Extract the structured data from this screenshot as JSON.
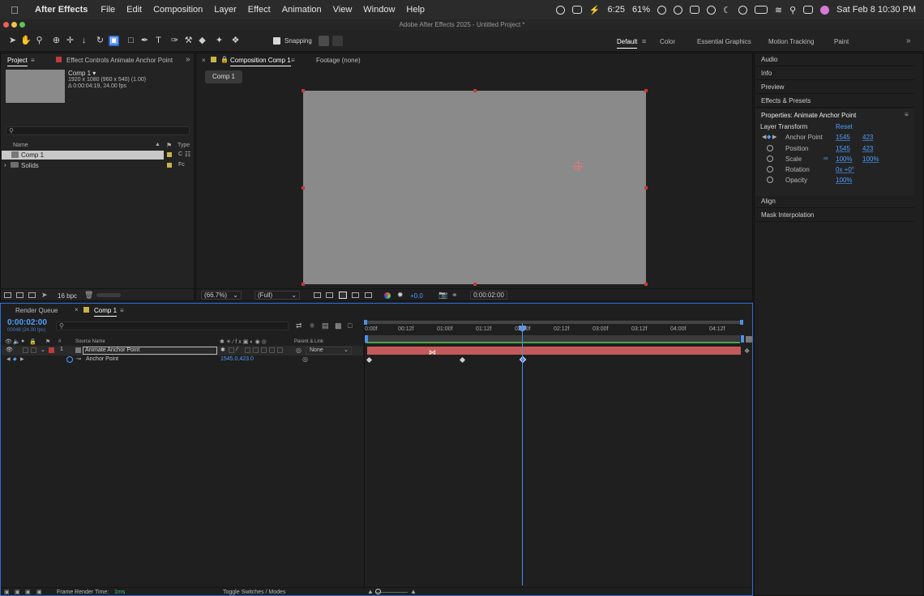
{
  "menubar": {
    "app_name": "After Effects",
    "items": [
      "File",
      "Edit",
      "Composition",
      "Layer",
      "Effect",
      "Animation",
      "View",
      "Window",
      "Help"
    ],
    "battery_time": "6:25",
    "battery_pct": "61%",
    "datetime": "Sat Feb 8  10:30 PM"
  },
  "window": {
    "title": "Adobe After Effects 2025 - Untitled Project *"
  },
  "toolbar": {
    "snapping_label": "Snapping",
    "workspaces": [
      "Default",
      "Color",
      "Essential Graphics",
      "Motion Tracking",
      "Paint"
    ],
    "active_workspace": "Default"
  },
  "project_panel": {
    "tab_project": "Project",
    "tab_effect_controls": "Effect Controls Animate Anchor Point",
    "comp_name": "Comp 1 ▾",
    "comp_dims": "1920 x 1080  (960 x 540) (1.00)",
    "comp_duration": "Δ 0:00:04:19, 24.00 fps",
    "col_name": "Name",
    "col_type": "Type",
    "items": [
      {
        "name": "Comp 1",
        "type": "C"
      },
      {
        "name": "Solids",
        "type": "Fc"
      }
    ],
    "bpc": "16 bpc"
  },
  "comp_panel": {
    "tab_comp": "Composition Comp 1",
    "tab_footage": "Footage (none)",
    "comp_chip": "Comp 1",
    "zoom": "(66.7%)",
    "resolution": "(Full)",
    "exposure": "+0.0",
    "timecode": "0:00:02:00"
  },
  "right_panel": {
    "items_top": [
      "Audio",
      "Info",
      "Preview",
      "Effects & Presets"
    ],
    "properties_title": "Properties: Animate Anchor Point",
    "layer_transform": "Layer Transform",
    "reset": "Reset",
    "props": [
      {
        "name": "Anchor Point",
        "v1": "1545",
        "v2": "423"
      },
      {
        "name": "Position",
        "v1": "1545",
        "v2": "423"
      },
      {
        "name": "Scale",
        "v1": "100%",
        "v2": "100%"
      },
      {
        "name": "Rotation",
        "v1": "0x +0°",
        "v2": ""
      },
      {
        "name": "Opacity",
        "v1": "100%",
        "v2": ""
      }
    ],
    "items_bottom": [
      "Align",
      "Mask Interpolation"
    ]
  },
  "timeline": {
    "tab_render_queue": "Render Queue",
    "tab_comp": "Comp 1",
    "current_time": "0:00:02:00",
    "frame_info": "00048 (24.00 fps)",
    "col_source_name": "Source Name",
    "col_parent": "Parent & Link",
    "layer_number": "1",
    "layer_name": "Animate Anchor Point",
    "parent_value": "None",
    "property_name": "Anchor Point",
    "property_value": "1545.0,423.0",
    "ruler_labels": [
      "0:00f",
      "00:12f",
      "01:00f",
      "01:12f",
      "02:00f",
      "02:12f",
      "03:00f",
      "03:12f",
      "04:00f",
      "04:12f"
    ],
    "frame_render_label": "Frame Render Time:",
    "frame_render_value": "1ms",
    "toggle_label": "Toggle Switches / Modes"
  },
  "colors": {
    "accent": "#2c6dd6",
    "layer_bar": "#c45a5a",
    "playhead": "#4d8fe6",
    "link": "#4e9fff"
  }
}
